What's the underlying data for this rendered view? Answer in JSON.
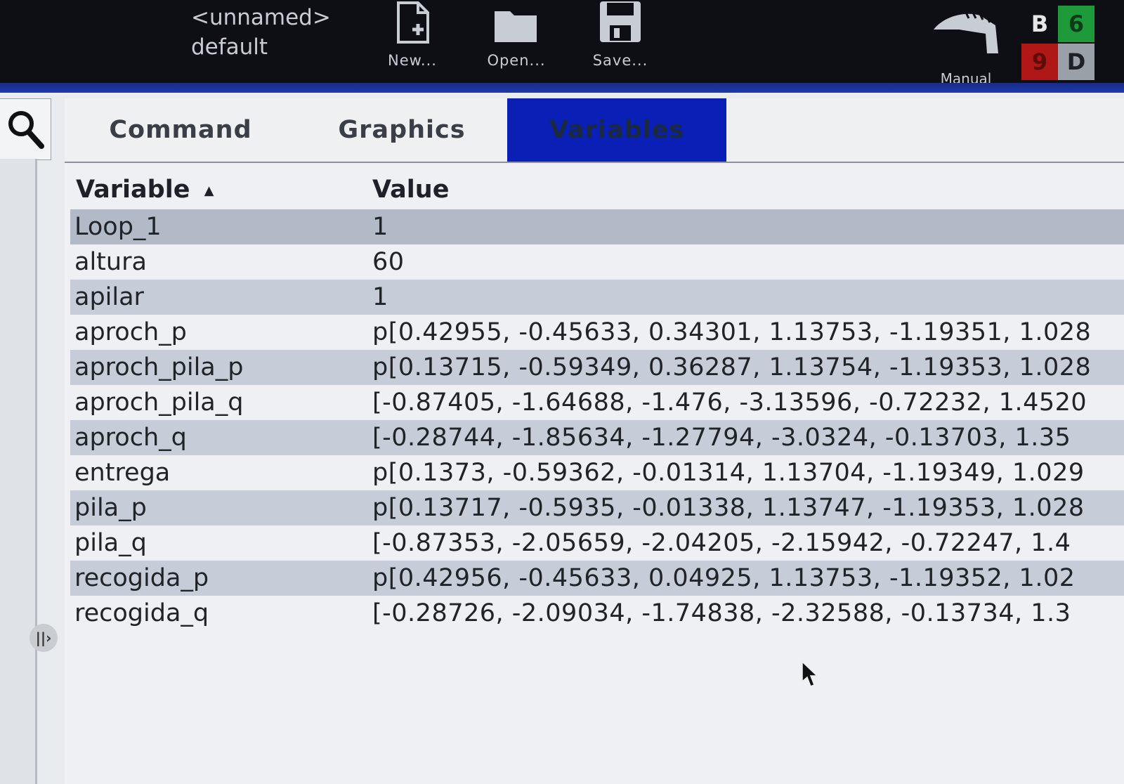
{
  "header": {
    "program_line1": "<unnamed>",
    "program_line2": "default",
    "toolbar": [
      {
        "label": "New...",
        "icon": "new-file-icon"
      },
      {
        "label": "Open...",
        "icon": "open-folder-icon"
      },
      {
        "label": "Save...",
        "icon": "save-disk-icon"
      }
    ],
    "mode_label": "Manual",
    "status_tiles": [
      {
        "text": "B",
        "color": "#111111"
      },
      {
        "text": "6",
        "color": "#1f9a3a"
      },
      {
        "text": "9",
        "color": "#b01818"
      },
      {
        "text": "D",
        "color": "#9aa0a8"
      }
    ]
  },
  "tabs": [
    {
      "label": "Command",
      "active": false
    },
    {
      "label": "Graphics",
      "active": false
    },
    {
      "label": "Variables",
      "active": true
    }
  ],
  "table": {
    "columns": [
      "Variable",
      "Value"
    ],
    "sort_indicator": "▲",
    "rows": [
      {
        "name": "Loop_1",
        "value": "1"
      },
      {
        "name": "altura",
        "value": "60"
      },
      {
        "name": "apilar",
        "value": "1"
      },
      {
        "name": "aproch_p",
        "value": "p[0.42955, -0.45633, 0.34301, 1.13753, -1.19351, 1.028"
      },
      {
        "name": "aproch_pila_p",
        "value": "p[0.13715, -0.59349, 0.36287, 1.13754, -1.19353, 1.028"
      },
      {
        "name": "aproch_pila_q",
        "value": "[-0.87405, -1.64688, -1.476, -3.13596, -0.72232, 1.4520"
      },
      {
        "name": "aproch_q",
        "value": "[-0.28744, -1.85634, -1.27794, -3.0324, -0.13703, 1.35"
      },
      {
        "name": "entrega",
        "value": "p[0.1373, -0.59362, -0.01314, 1.13704, -1.19349, 1.029"
      },
      {
        "name": "pila_p",
        "value": "p[0.13717, -0.5935, -0.01338, 1.13747, -1.19353, 1.028"
      },
      {
        "name": "pila_q",
        "value": "[-0.87353, -2.05659, -2.04205, -2.15942, -0.72247, 1.4"
      },
      {
        "name": "recogida_p",
        "value": "p[0.42956, -0.45633, 0.04925, 1.13753, -1.19352, 1.02"
      },
      {
        "name": "recogida_q",
        "value": "[-0.28726, -2.09034, -1.74838, -2.32588, -0.13734, 1.3"
      }
    ]
  },
  "colors": {
    "active_tab": "#0a1fb5",
    "row_alt": "#c7cdd8",
    "header_bg": "#0d0f14"
  }
}
